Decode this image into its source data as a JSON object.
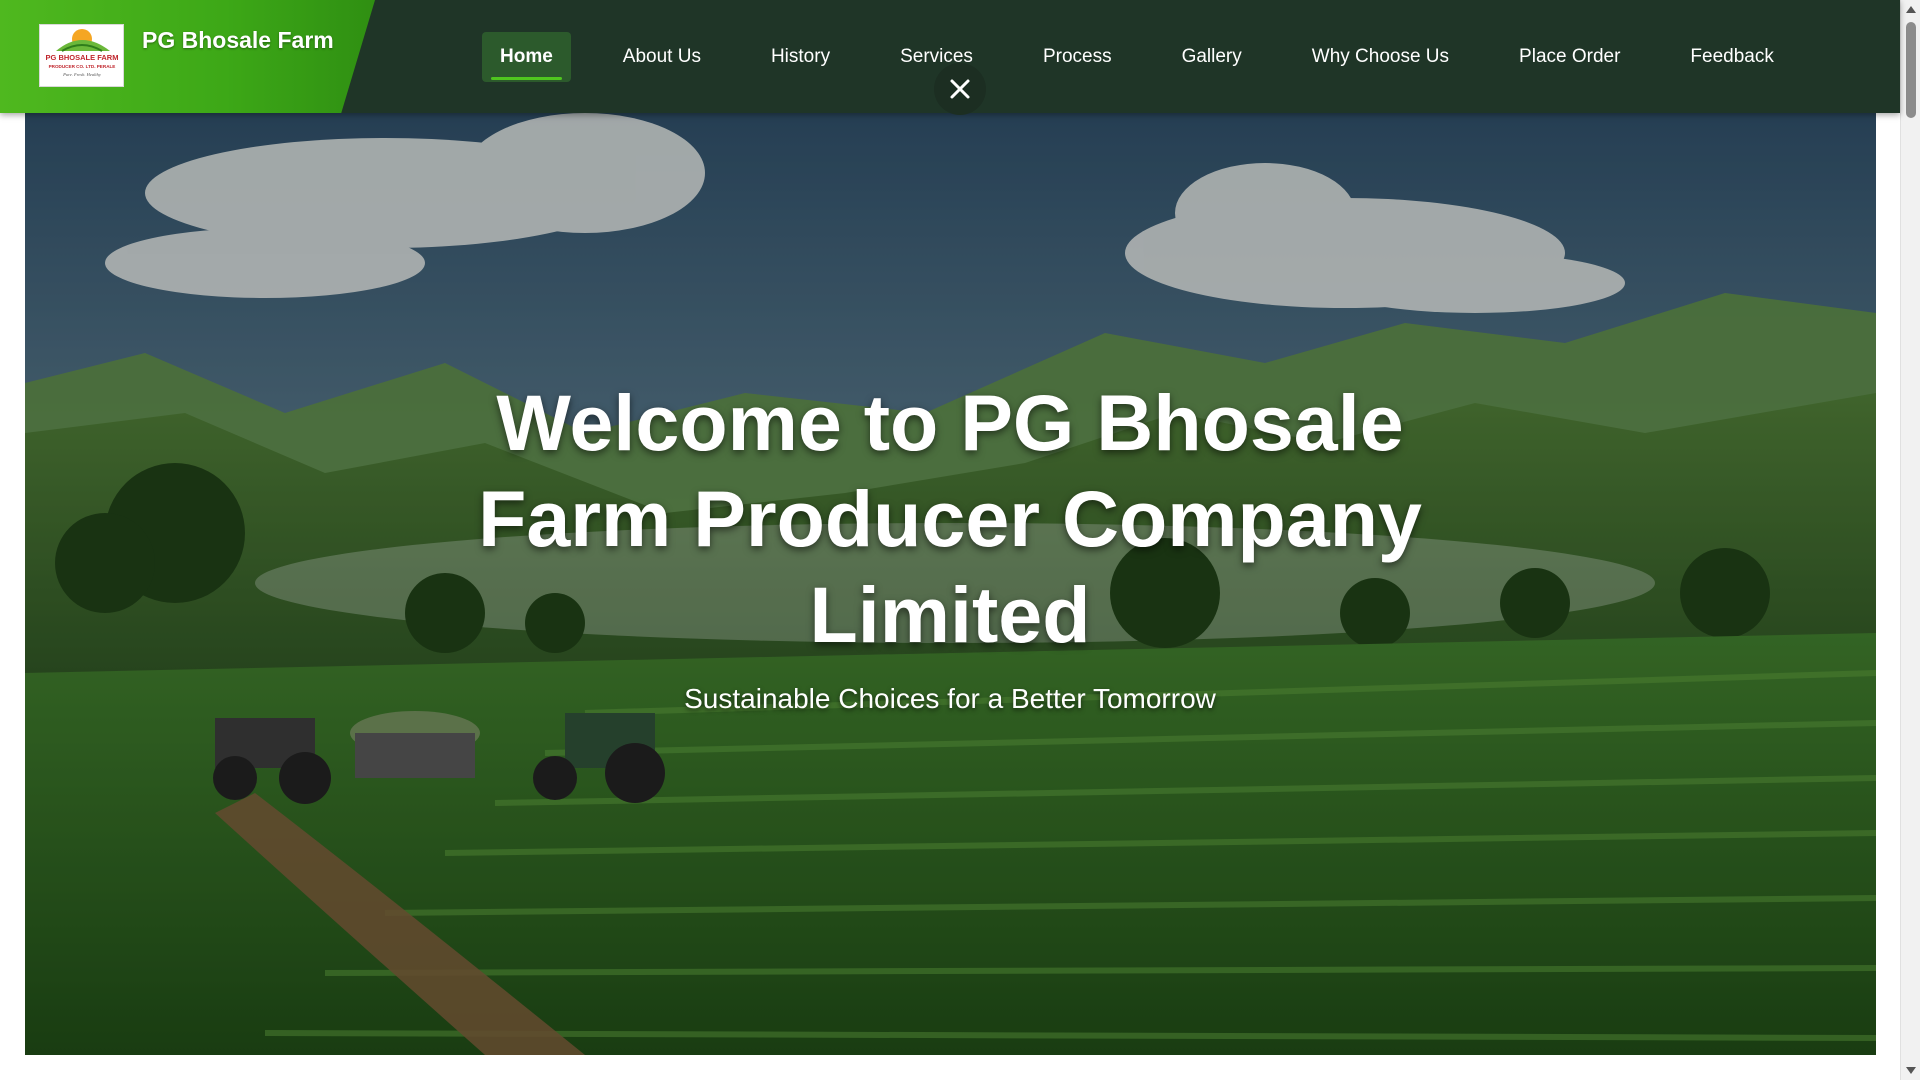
{
  "brand": {
    "name": "PG Bhosale Farm",
    "logo_text": "PG BHOSALE FARM",
    "logo_subtext": "PRODUCER CO. LTD. PERALE",
    "logo_tagline": "Pure. Fresh. Healthy"
  },
  "nav": {
    "items": [
      {
        "label": "Home",
        "active": true
      },
      {
        "label": "About Us"
      },
      {
        "label": "History"
      },
      {
        "label": "Services"
      },
      {
        "label": "Process"
      },
      {
        "label": "Gallery"
      },
      {
        "label": "Why Choose Us"
      },
      {
        "label": "Place Order"
      },
      {
        "label": "Feedback"
      }
    ],
    "close_icon": "close-icon"
  },
  "hero": {
    "title": "Welcome to PG Bhosale Farm Producer Company Limited",
    "subtitle": "Sustainable Choices for a Better Tomorrow"
  },
  "colors": {
    "header_bg": "#1f3527",
    "brand_green": "#4fb81f",
    "nav_active_bg": "#2c5a2c",
    "nav_active_underline": "#4fc51f"
  }
}
